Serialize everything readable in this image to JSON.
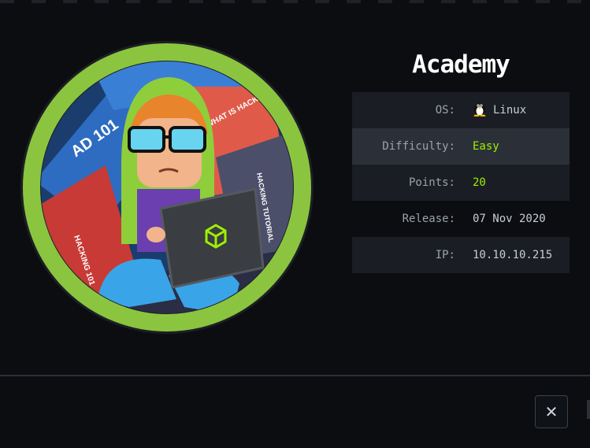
{
  "machine": {
    "name": "Academy",
    "avatar_icon": "hacker-avatar-icon",
    "accent_color": "#9fef00",
    "rows": [
      {
        "label": "OS:",
        "value": "Linux",
        "icon": "tux-icon"
      },
      {
        "label": "Difficulty:",
        "value": "Easy"
      },
      {
        "label": "Points:",
        "value": "20"
      },
      {
        "label": "Release:",
        "value": "07 Nov 2020"
      },
      {
        "label": "IP:",
        "value": "10.10.10.215"
      }
    ]
  },
  "avatar_books": {
    "book1": "AD 101",
    "book2": "WHAT IS HACKING?",
    "book3": "HACKING 101",
    "book4": "HACKING TUTORIAL"
  },
  "footer": {
    "close_label": "✕",
    "close_icon": "close-icon"
  }
}
